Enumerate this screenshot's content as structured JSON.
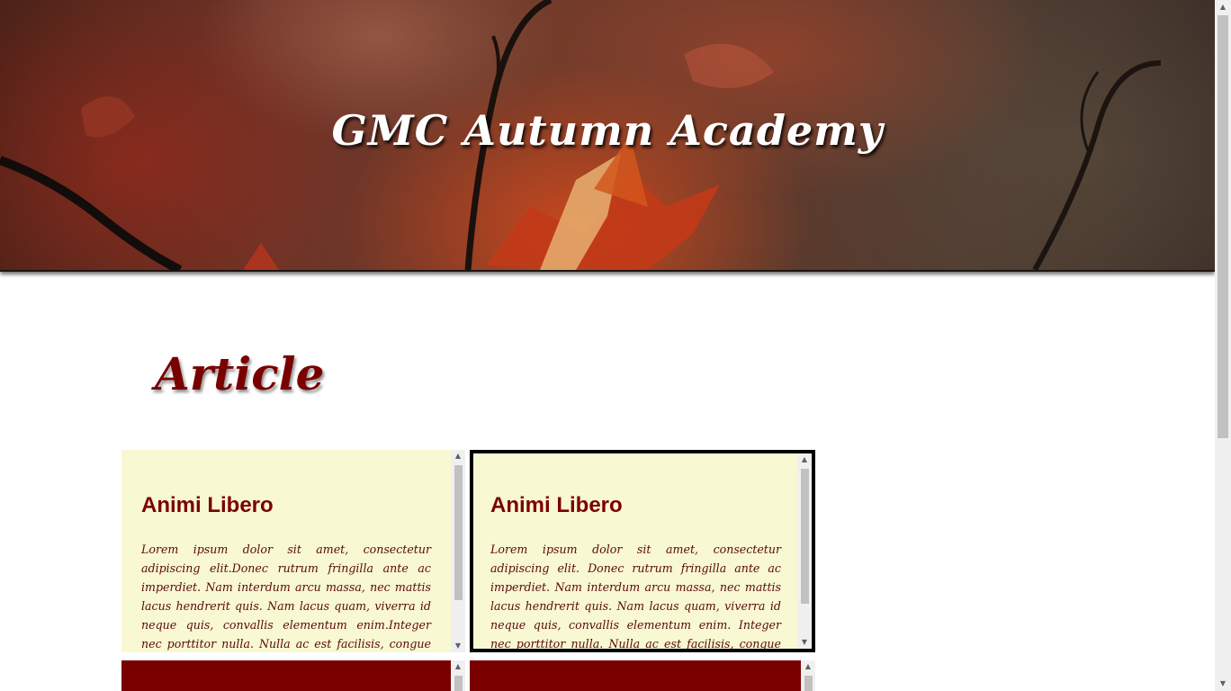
{
  "header": {
    "title": "GMC Autumn Academy",
    "background_image": "autumn-leaves-branches"
  },
  "main": {
    "section_title": "Article",
    "articles": [
      {
        "heading": "Animi Libero",
        "body": "Lorem ipsum dolor sit amet, consectetur adipiscing elit.Donec rutrum fringilla ante ac imperdiet. Nam interdum arcu massa, nec mattis lacus hendrerit quis. Nam lacus quam, viverra id neque quis, convallis elementum enim.Integer nec porttitor nulla. Nulla ac est facilisis, congue ex quis, fringilla",
        "selected": false
      },
      {
        "heading": "Animi Libero",
        "body": "Lorem ipsum dolor sit amet, consectetur adipiscing elit. Donec rutrum fringilla ante ac imperdiet. Nam interdum arcu massa, nec mattis lacus hendrerit quis. Nam lacus quam, viverra id neque quis, convallis elementum enim. Integer nec porttitor nulla. Nulla ac est facilisis, congue ex quis, fringilla",
        "selected": true
      }
    ]
  },
  "scroll_icons": {
    "up": "▲",
    "down": "▼"
  },
  "colors": {
    "accent": "#7a0000",
    "card_background": "#f8f8d2",
    "selected_border": "#000000"
  }
}
